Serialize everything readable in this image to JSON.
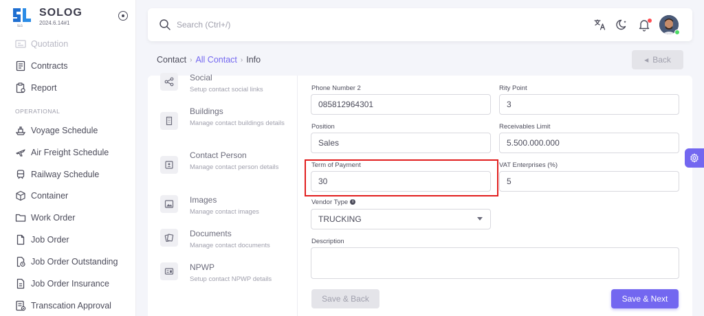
{
  "brand": {
    "name": "SOLOG",
    "version": "2024.6.14#1",
    "logo_caption": "SLG"
  },
  "sidebar": {
    "items_top": [
      {
        "label": "Quotation",
        "icon": "quotation-icon"
      },
      {
        "label": "Contracts",
        "icon": "contracts-icon"
      },
      {
        "label": "Report",
        "icon": "report-icon"
      }
    ],
    "section_label": "OPERATIONAL",
    "items": [
      {
        "label": "Voyage Schedule",
        "icon": "ship-icon"
      },
      {
        "label": "Air Freight Schedule",
        "icon": "plane-icon"
      },
      {
        "label": "Railway Schedule",
        "icon": "train-icon"
      },
      {
        "label": "Container",
        "icon": "box-icon"
      },
      {
        "label": "Work Order",
        "icon": "folder-icon"
      },
      {
        "label": "Job Order",
        "icon": "file-icon"
      },
      {
        "label": "Job Order Outstanding",
        "icon": "file-clock-icon"
      },
      {
        "label": "Job Order Insurance",
        "icon": "file-text-icon"
      },
      {
        "label": "Transcation Approval",
        "icon": "list-check-icon"
      }
    ]
  },
  "topbar": {
    "search_placeholder": "Search (Ctrl+/)"
  },
  "breadcrumb": {
    "items": [
      "Contact",
      "All Contact",
      "Info"
    ],
    "back_label": "Back"
  },
  "tabs": [
    {
      "title": "Social",
      "desc": "Setup contact social links",
      "icon": "share-icon"
    },
    {
      "title": "Buildings",
      "desc": "Manage contact buildings details",
      "icon": "building-icon"
    },
    {
      "title": "Contact Person",
      "desc": "Manage contact person details",
      "icon": "id-card-icon"
    },
    {
      "title": "Images",
      "desc": "Manage contact images",
      "icon": "image-icon"
    },
    {
      "title": "Documents",
      "desc": "Manage contact documents",
      "icon": "documents-icon"
    },
    {
      "title": "NPWP",
      "desc": "Setup contact NPWP details",
      "icon": "tax-card-icon"
    }
  ],
  "form": {
    "phone2": {
      "label": "Phone Number 2",
      "value": "085812964301"
    },
    "rity_point": {
      "label": "Rity Point",
      "value": "3"
    },
    "position": {
      "label": "Position",
      "value": "Sales"
    },
    "receivables_limit": {
      "label": "Receivables Limit",
      "value": "5.500.000.000"
    },
    "term_of_payment": {
      "label": "Term of Payment",
      "value": "30"
    },
    "vat": {
      "label": "VAT Enterprises (%)",
      "value": "5"
    },
    "vendor_type": {
      "label": "Vendor Type",
      "value": "TRUCKING"
    },
    "description": {
      "label": "Description",
      "value": ""
    }
  },
  "actions": {
    "save_back": "Save & Back",
    "save_next": "Save & Next"
  },
  "colors": {
    "primary": "#7367f0",
    "highlight": "#e11d1d",
    "online": "#4cd964",
    "notification": "#ff4c51"
  }
}
